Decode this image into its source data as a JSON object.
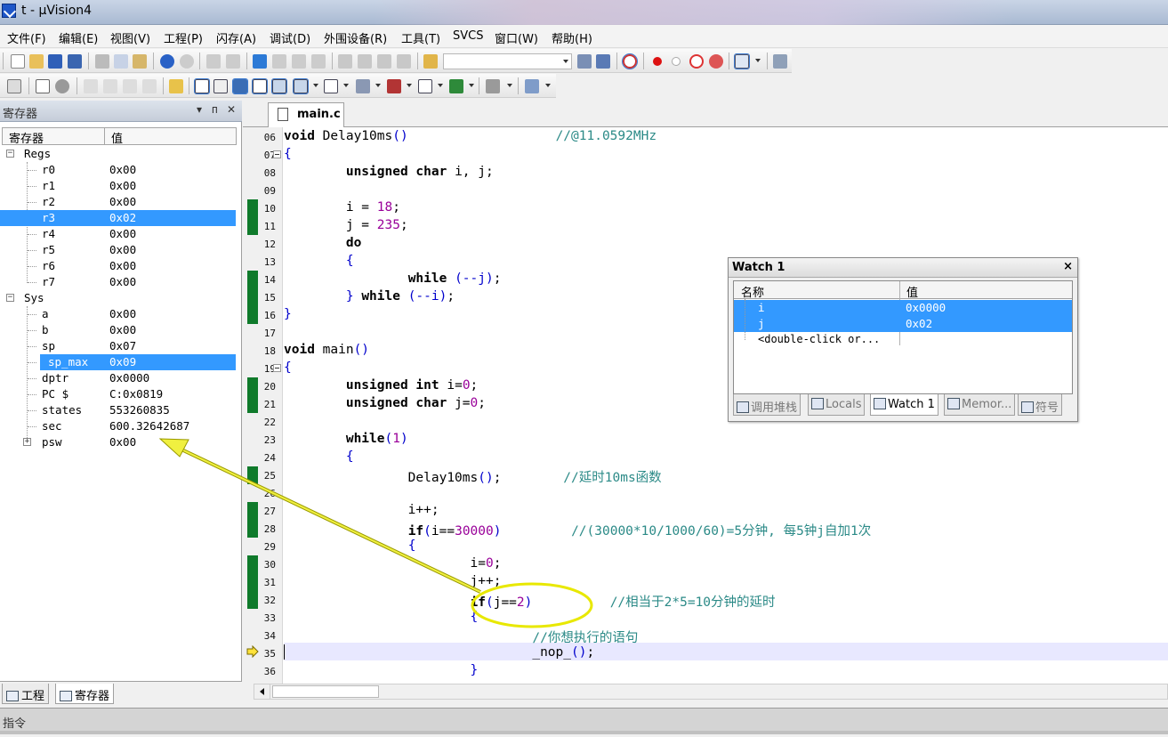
{
  "window": {
    "title": "t  - µVision4"
  },
  "menu": [
    "文件(F)",
    "编辑(E)",
    "视图(V)",
    "工程(P)",
    "闪存(A)",
    "调试(D)",
    "外围设备(R)",
    "工具(T)",
    "SVCS",
    "窗口(W)",
    "帮助(H)"
  ],
  "registers_panel": {
    "title": "寄存器",
    "buttons": [
      "▾",
      "ᴨ",
      "✕"
    ],
    "col_name": "寄存器",
    "col_value": "值",
    "groups": {
      "regs": "Regs",
      "sys": "Sys"
    },
    "regs": [
      {
        "name": "r0",
        "value": "0x00"
      },
      {
        "name": "r1",
        "value": "0x00"
      },
      {
        "name": "r2",
        "value": "0x00"
      },
      {
        "name": "r3",
        "value": "0x02"
      },
      {
        "name": "r4",
        "value": "0x00"
      },
      {
        "name": "r5",
        "value": "0x00"
      },
      {
        "name": "r6",
        "value": "0x00"
      },
      {
        "name": "r7",
        "value": "0x00"
      }
    ],
    "sys": [
      {
        "name": "a",
        "value": "0x00"
      },
      {
        "name": "b",
        "value": "0x00"
      },
      {
        "name": "sp",
        "value": "0x07"
      },
      {
        "name": "sp_max",
        "value": "0x09"
      },
      {
        "name": "dptr",
        "value": "0x0000"
      },
      {
        "name": "PC  $",
        "value": "C:0x0819"
      },
      {
        "name": "states",
        "value": "553260835"
      },
      {
        "name": "sec",
        "value": "600.32642687"
      },
      {
        "name": "psw",
        "value": "0x00"
      }
    ],
    "tabs": [
      "工程",
      "寄存器"
    ]
  },
  "editor": {
    "file_tab": "main.c",
    "lines": [
      {
        "no": "06",
        "code": [
          [
            "kw",
            "void"
          ],
          [
            "op",
            " Delay10ms"
          ],
          [
            "pu",
            "()"
          ],
          [
            "op",
            "                   "
          ],
          [
            "cm",
            "//@11.0592MHz"
          ]
        ]
      },
      {
        "no": "07",
        "code": [
          [
            "pu",
            "{"
          ]
        ]
      },
      {
        "no": "08",
        "code": [
          [
            "op",
            "        "
          ],
          [
            "kw",
            "unsigned char"
          ],
          [
            "op",
            " i, j;"
          ]
        ]
      },
      {
        "no": "09",
        "code": []
      },
      {
        "no": "10",
        "code": [
          [
            "op",
            "        i = "
          ],
          [
            "num",
            "18"
          ],
          [
            "op",
            ";"
          ]
        ]
      },
      {
        "no": "11",
        "code": [
          [
            "op",
            "        j = "
          ],
          [
            "num",
            "235"
          ],
          [
            "op",
            ";"
          ]
        ]
      },
      {
        "no": "12",
        "code": [
          [
            "op",
            "        "
          ],
          [
            "kw",
            "do"
          ]
        ]
      },
      {
        "no": "13",
        "code": [
          [
            "op",
            "        "
          ],
          [
            "pu",
            "{"
          ]
        ]
      },
      {
        "no": "14",
        "code": [
          [
            "op",
            "                "
          ],
          [
            "kw",
            "while"
          ],
          [
            "op",
            " "
          ],
          [
            "pu",
            "(--j)"
          ],
          [
            "op",
            ";"
          ]
        ]
      },
      {
        "no": "15",
        "code": [
          [
            "op",
            "        "
          ],
          [
            "pu",
            "}"
          ],
          [
            "op",
            " "
          ],
          [
            "kw",
            "while"
          ],
          [
            "op",
            " "
          ],
          [
            "pu",
            "(--i)"
          ],
          [
            "op",
            ";"
          ]
        ]
      },
      {
        "no": "16",
        "code": [
          [
            "pu",
            "}"
          ]
        ]
      },
      {
        "no": "17",
        "code": []
      },
      {
        "no": "18",
        "code": [
          [
            "kw",
            "void"
          ],
          [
            "op",
            " main"
          ],
          [
            "pu",
            "()"
          ]
        ]
      },
      {
        "no": "19",
        "code": [
          [
            "pu",
            "{"
          ]
        ]
      },
      {
        "no": "20",
        "code": [
          [
            "op",
            "        "
          ],
          [
            "kw",
            "unsigned int"
          ],
          [
            "op",
            " i="
          ],
          [
            "num",
            "0"
          ],
          [
            "op",
            ";"
          ]
        ]
      },
      {
        "no": "21",
        "code": [
          [
            "op",
            "        "
          ],
          [
            "kw",
            "unsigned char"
          ],
          [
            "op",
            " j="
          ],
          [
            "num",
            "0"
          ],
          [
            "op",
            ";"
          ]
        ]
      },
      {
        "no": "22",
        "code": []
      },
      {
        "no": "23",
        "code": [
          [
            "op",
            "        "
          ],
          [
            "kw",
            "while"
          ],
          [
            "pu",
            "("
          ],
          [
            "num",
            "1"
          ],
          [
            "pu",
            ")"
          ]
        ]
      },
      {
        "no": "24",
        "code": [
          [
            "op",
            "        "
          ],
          [
            "pu",
            "{"
          ]
        ]
      },
      {
        "no": "25",
        "code": [
          [
            "op",
            "                Delay10ms"
          ],
          [
            "pu",
            "()"
          ],
          [
            "op",
            ";        "
          ],
          [
            "cm",
            "//延时10ms函数"
          ]
        ]
      },
      {
        "no": "26",
        "code": []
      },
      {
        "no": "27",
        "code": [
          [
            "op",
            "                i++;"
          ]
        ]
      },
      {
        "no": "28",
        "code": [
          [
            "op",
            "                "
          ],
          [
            "kw",
            "if"
          ],
          [
            "pu",
            "("
          ],
          [
            "op",
            "i=="
          ],
          [
            "num",
            "30000"
          ],
          [
            "pu",
            ")"
          ],
          [
            "op",
            "         "
          ],
          [
            "cm",
            "//(30000*10/1000/60)=5分钟, 每5钟j自加1次"
          ]
        ]
      },
      {
        "no": "29",
        "code": [
          [
            "op",
            "                "
          ],
          [
            "pu",
            "{"
          ]
        ]
      },
      {
        "no": "30",
        "code": [
          [
            "op",
            "                        i="
          ],
          [
            "num",
            "0"
          ],
          [
            "op",
            ";"
          ]
        ]
      },
      {
        "no": "31",
        "code": [
          [
            "op",
            "                        j++;"
          ]
        ]
      },
      {
        "no": "32",
        "code": [
          [
            "op",
            "                        "
          ],
          [
            "kw",
            "if"
          ],
          [
            "pu",
            "("
          ],
          [
            "op",
            "j=="
          ],
          [
            "num",
            "2"
          ],
          [
            "pu",
            ")"
          ],
          [
            "op",
            "          "
          ],
          [
            "cm",
            "//相当于2*5=10分钟的延时"
          ]
        ]
      },
      {
        "no": "33",
        "code": [
          [
            "op",
            "                        "
          ],
          [
            "pu",
            "{"
          ]
        ]
      },
      {
        "no": "34",
        "code": [
          [
            "op",
            "                                "
          ],
          [
            "cm",
            "//你想执行的语句"
          ]
        ]
      },
      {
        "no": "35",
        "code": [
          [
            "op",
            "                                _nop_"
          ],
          [
            "pu",
            "()"
          ],
          [
            "op",
            ";"
          ]
        ]
      },
      {
        "no": "36",
        "code": [
          [
            "op",
            "                        "
          ],
          [
            "pu",
            "}"
          ]
        ]
      }
    ],
    "covered_lines": [
      "10",
      "11",
      "14",
      "15",
      "16",
      "20",
      "21",
      "25",
      "27",
      "28",
      "30",
      "31",
      "32"
    ],
    "current_line": "35"
  },
  "watch": {
    "title": "Watch 1",
    "col_name": "名称",
    "col_value": "值",
    "rows": [
      {
        "name": "i",
        "value": "0x0000"
      },
      {
        "name": "j",
        "value": "0x02"
      },
      {
        "name": "<double-click or...",
        "value": ""
      }
    ],
    "tabs": [
      "调用堆栈",
      "Locals",
      "Watch 1",
      "Memor...",
      "符号"
    ],
    "close": "×"
  },
  "command": {
    "label": "指令"
  },
  "colors": {
    "highlight": "#3399ff",
    "coverage": "#0f7a2b",
    "annotation": "#e8e800"
  }
}
